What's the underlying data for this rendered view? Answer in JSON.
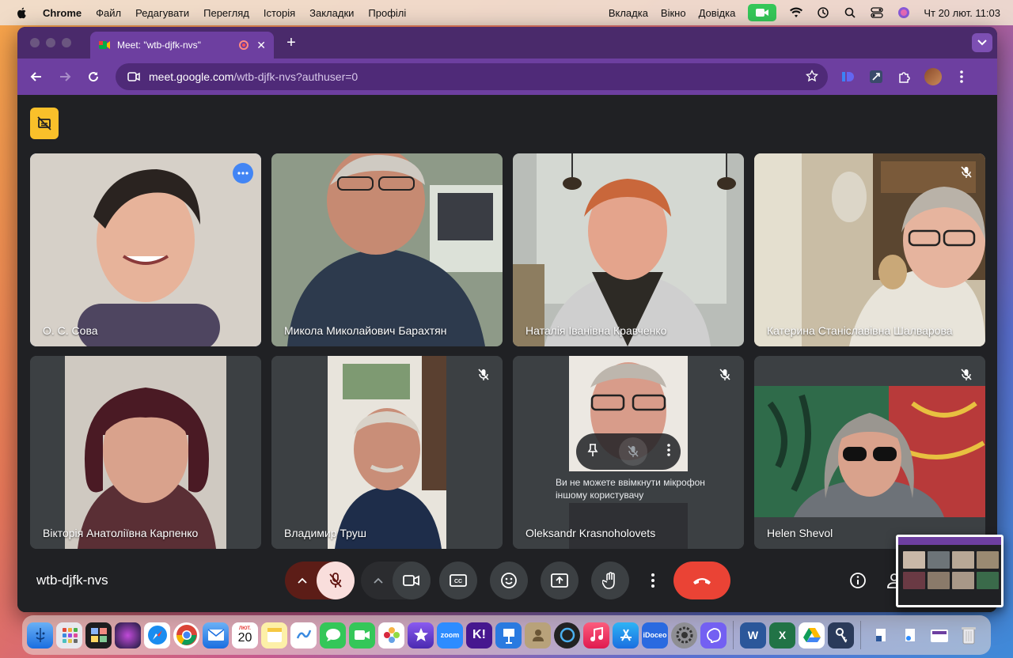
{
  "menubar": {
    "app_name": "Chrome",
    "items": [
      "Файл",
      "Редагувати",
      "Перегляд",
      "Історія",
      "Закладки",
      "Профілі"
    ],
    "right_items": [
      "Вкладка",
      "Вікно",
      "Довідка"
    ],
    "datetime": "Чт 20 лют.  11:03"
  },
  "browser": {
    "tab_title": "Meet: \"wtb-djfk-nvs\"",
    "url_host": "meet.google.com",
    "url_path": "/wtb-djfk-nvs?authuser=0"
  },
  "meet": {
    "meeting_code": "wtb-djfk-nvs",
    "participants": [
      {
        "name": "О. С. Сова",
        "muted": false,
        "active": true
      },
      {
        "name": "Микола Миколайович Барахтян",
        "muted": false,
        "active": false
      },
      {
        "name": "Наталія Іванівна Кравченко",
        "muted": false,
        "active": false
      },
      {
        "name": "Катерина Станіславівна Шалварова",
        "muted": true,
        "active": false
      },
      {
        "name": "Вікторія Анатоліївна Карпенко",
        "muted": false,
        "active": false
      },
      {
        "name": "Владимир Труш",
        "muted": true,
        "active": false
      },
      {
        "name": "Oleksandr Krasnoholovets",
        "muted": true,
        "active": false
      },
      {
        "name": "Helen Shevol",
        "muted": true,
        "active": false
      }
    ],
    "tooltip": "Ви не можете ввімкнути мікрофон іншому користувачу"
  },
  "dock": {
    "calendar_month": "ЛЮТ.",
    "calendar_day": "20",
    "zoom_label": "zoom",
    "idoceo_label": "iDoceo"
  },
  "colors": {
    "chrome_purple": "#6d3fa0",
    "meet_bg": "#202124",
    "end_call": "#ea4335",
    "active_outline": "#8ab4f8"
  }
}
